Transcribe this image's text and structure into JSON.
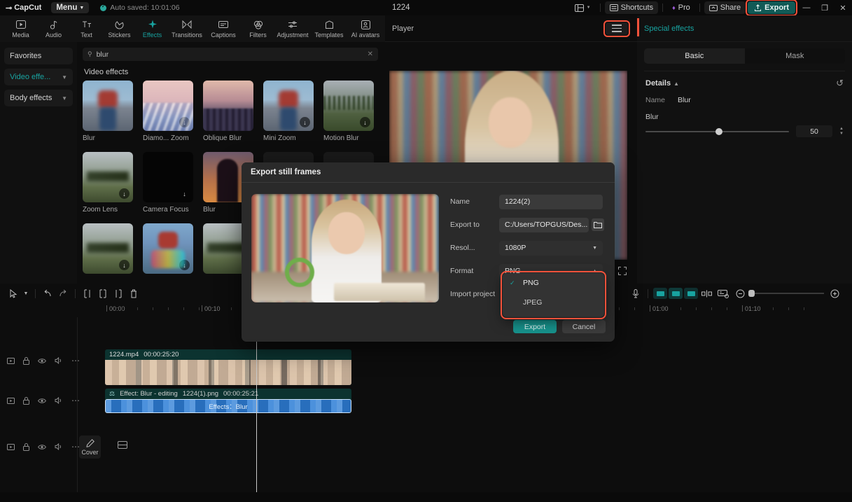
{
  "titlebar": {
    "brand": "CapCut",
    "menu_label": "Menu",
    "autosave_text": "Auto saved: 10:01:06",
    "project_name": "1224",
    "shortcuts_label": "Shortcuts",
    "pro_label": "Pro",
    "share_label": "Share",
    "export_label": "Export",
    "minimize": "—",
    "maximize": "❐",
    "close": "✕",
    "accent_teal": "#18a3a0",
    "highlight_red": "#f4523b"
  },
  "topnav": {
    "tabs": [
      {
        "label": "Media",
        "icon": "media-icon",
        "active": false
      },
      {
        "label": "Audio",
        "icon": "audio-icon",
        "active": false
      },
      {
        "label": "Text",
        "icon": "text-icon",
        "active": false
      },
      {
        "label": "Stickers",
        "icon": "stickers-icon",
        "active": false
      },
      {
        "label": "Effects",
        "icon": "effects-icon",
        "active": true
      },
      {
        "label": "Transitions",
        "icon": "transitions-icon",
        "active": false
      },
      {
        "label": "Captions",
        "icon": "captions-icon",
        "active": false
      },
      {
        "label": "Filters",
        "icon": "filters-icon",
        "active": false
      },
      {
        "label": "Adjustment",
        "icon": "adjustment-icon",
        "active": false
      },
      {
        "label": "Templates",
        "icon": "templates-icon",
        "active": false
      },
      {
        "label": "AI avatars",
        "icon": "ai-avatars-icon",
        "active": false
      }
    ]
  },
  "left_panel": {
    "categories": [
      {
        "label": "Favorites",
        "selected": false,
        "has_chevron": false
      },
      {
        "label": "Video effe...",
        "selected": true,
        "has_chevron": true
      },
      {
        "label": "Body effects",
        "selected": false,
        "has_chevron": true
      }
    ],
    "search": {
      "value": "blur",
      "placeholder": "Search effects"
    },
    "section_title": "Video effects",
    "effects": [
      {
        "label": "Blur",
        "art": "t-person",
        "download": false
      },
      {
        "label": "Diamo... Zoom",
        "art": "t-diamond",
        "download": true
      },
      {
        "label": "Oblique Blur",
        "art": "t-city",
        "download": true
      },
      {
        "label": "Mini Zoom",
        "art": "t-person",
        "download": true
      },
      {
        "label": "Motion Blur",
        "art": "t-forest",
        "download": true
      },
      {
        "label": "Zoom Lens",
        "art": "t-field",
        "download": true
      },
      {
        "label": "Camera Focus",
        "art": "t-black",
        "download": true
      },
      {
        "label": "Blur",
        "art": "t-silh",
        "download": false
      },
      {
        "label": "",
        "art": "t-blank",
        "download": false
      },
      {
        "label": "",
        "art": "t-blank",
        "download": false
      },
      {
        "label": "",
        "art": "t-field",
        "download": true
      },
      {
        "label": "",
        "art": "t-rgb",
        "download": true
      },
      {
        "label": "",
        "art": "t-field",
        "download": false
      }
    ]
  },
  "player": {
    "title": "Player",
    "menu_icon": "hamburger-menu-icon"
  },
  "right_panel": {
    "title": "Special effects",
    "tabs": [
      {
        "label": "Basic",
        "active": true
      },
      {
        "label": "Mask",
        "active": false
      }
    ],
    "details_label": "Details",
    "reset_icon": "reset-icon",
    "name_key": "Name",
    "name_value": "Blur",
    "slider_label": "Blur",
    "slider_value": "50",
    "slider_percent": 49
  },
  "dialog": {
    "title": "Export still frames",
    "fields": [
      {
        "label": "Name",
        "value": "1224(2)",
        "type": "text"
      },
      {
        "label": "Export to",
        "value": "C:/Users/TOPGUS/Des...",
        "type": "path"
      },
      {
        "label": "Resol...",
        "value": "1080P",
        "type": "select"
      },
      {
        "label": "Format",
        "value": "PNG",
        "type": "select-open"
      },
      {
        "label": "Import project",
        "value": "",
        "type": "label-only"
      }
    ],
    "dropdown": {
      "options": [
        {
          "label": "PNG",
          "checked": true
        },
        {
          "label": "JPEG",
          "checked": false
        }
      ]
    },
    "export_button": "Export",
    "cancel_button": "Cancel",
    "folder_icon": "folder-icon",
    "expand_icon": "expand-icon"
  },
  "timeline": {
    "toolbar_left": [
      {
        "icon": "select-cursor-icon"
      },
      {
        "icon": "chevron-down-icon"
      },
      {
        "icon": "undo-icon"
      },
      {
        "icon": "redo-icon"
      },
      {
        "icon": "split-left-icon"
      },
      {
        "icon": "split-icon"
      },
      {
        "icon": "split-right-icon"
      },
      {
        "icon": "delete-icon"
      }
    ],
    "toolbar_right": [
      {
        "icon": "microphone-icon"
      },
      {
        "icon": "keyframe-prev-icon"
      },
      {
        "icon": "keyframe-add-icon"
      },
      {
        "icon": "keyframe-next-icon"
      },
      {
        "icon": "mirror-icon"
      },
      {
        "icon": "fit-screen-icon"
      },
      {
        "icon": "zoom-out-icon"
      },
      {
        "icon": "zoom-in-icon"
      }
    ],
    "ruler_labels": [
      "00:00",
      "00:10",
      "01:00",
      "01:10"
    ],
    "track_controls": [
      "play-icon",
      "lock-icon",
      "eye-icon",
      "volume-icon",
      "more-icon"
    ],
    "clips": [
      {
        "kind": "video",
        "name": "1224.mp4",
        "duration": "00:00:25:20"
      },
      {
        "kind": "effect",
        "tag": "Effect: Blur - editing",
        "name": "1224(1).png",
        "duration": "00:00:25:21",
        "body_label": "Effects：Blur"
      }
    ],
    "cover_label": "Cover",
    "cover_icon": "pencil-icon",
    "split-view_icon": "split-view-icon"
  }
}
